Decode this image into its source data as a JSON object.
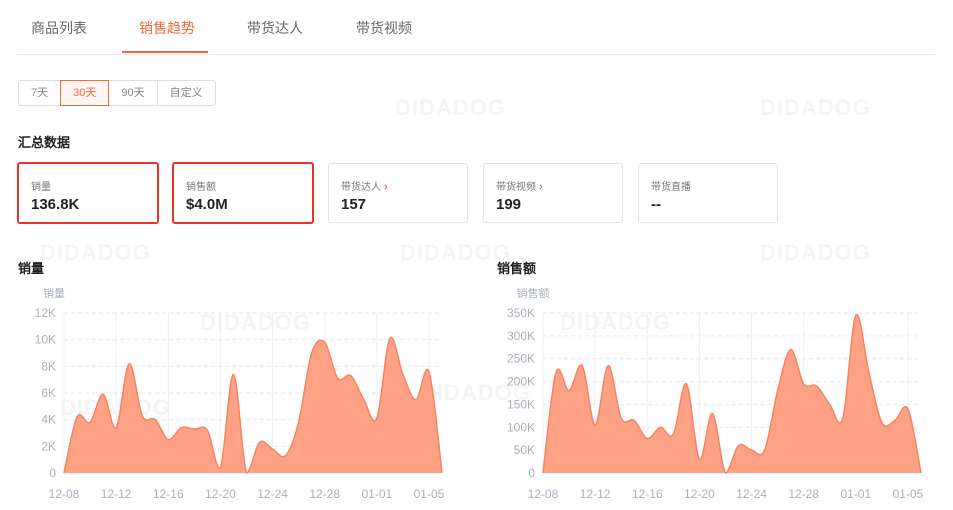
{
  "tabs": [
    {
      "label": "商品列表",
      "active": false
    },
    {
      "label": "销售趋势",
      "active": true
    },
    {
      "label": "带货达人",
      "active": false
    },
    {
      "label": "带货视频",
      "active": false
    }
  ],
  "ranges": [
    {
      "label": "7天",
      "active": false
    },
    {
      "label": "30天",
      "active": true
    },
    {
      "label": "90天",
      "active": false
    },
    {
      "label": "自定义",
      "active": false
    }
  ],
  "summary": {
    "title": "汇总数据",
    "cards": [
      {
        "label": "销量",
        "value": "136.8K",
        "link": false,
        "highlighted": true
      },
      {
        "label": "销售额",
        "value": "$4.0M",
        "link": false,
        "highlighted": true
      },
      {
        "label": "带货达人",
        "value": "157",
        "link": true,
        "highlighted": false
      },
      {
        "label": "带货视频",
        "value": "199",
        "link": true,
        "highlighted": false
      },
      {
        "label": "带货直播",
        "value": "--",
        "link": false,
        "highlighted": false
      }
    ]
  },
  "watermark": "DIDADOG",
  "colors": {
    "accent": "#f06a3a",
    "highlight_border": "#e8332a",
    "area_fill": "#ffa184",
    "area_stroke": "#f58466"
  },
  "chart_data": [
    {
      "type": "area",
      "title": "销量",
      "ylabel": "销量",
      "ylim": [
        0,
        12000
      ],
      "yticks": [
        0,
        2000,
        4000,
        6000,
        8000,
        10000,
        12000
      ],
      "ytick_labels": [
        "0",
        "2K",
        "4K",
        "6K",
        "8K",
        "10K",
        "12K"
      ],
      "xtick_labels": [
        "12-08",
        "12-12",
        "12-16",
        "12-20",
        "12-24",
        "12-28",
        "01-01",
        "01-05"
      ],
      "xtick_index": [
        0,
        4,
        8,
        12,
        16,
        20,
        24,
        28
      ],
      "x": [
        "12-08",
        "12-09",
        "12-10",
        "12-11",
        "12-12",
        "12-13",
        "12-14",
        "12-15",
        "12-16",
        "12-17",
        "12-18",
        "12-19",
        "12-20",
        "12-21",
        "12-22",
        "12-23",
        "12-24",
        "12-25",
        "12-26",
        "12-27",
        "12-28",
        "12-29",
        "12-30",
        "12-31",
        "01-01",
        "01-02",
        "01-03",
        "01-04",
        "01-05",
        "01-06"
      ],
      "values": [
        0,
        4200,
        3800,
        5900,
        3400,
        8200,
        4300,
        4000,
        2500,
        3400,
        3300,
        3200,
        400,
        7400,
        0,
        2300,
        1800,
        1300,
        3800,
        9000,
        9800,
        7100,
        7300,
        5500,
        4100,
        10100,
        7400,
        5500,
        7600,
        0
      ],
      "grid": true,
      "legend": "none"
    },
    {
      "type": "area",
      "title": "销售额",
      "ylabel": "销售额",
      "ylim": [
        0,
        350000
      ],
      "yticks": [
        0,
        50000,
        100000,
        150000,
        200000,
        250000,
        300000,
        350000
      ],
      "ytick_labels": [
        "0",
        "50K",
        "100K",
        "150K",
        "200K",
        "250K",
        "300K",
        "350K"
      ],
      "xtick_labels": [
        "12-08",
        "12-12",
        "12-16",
        "12-20",
        "12-24",
        "12-28",
        "01-01",
        "01-05"
      ],
      "xtick_index": [
        0,
        4,
        8,
        12,
        16,
        20,
        24,
        28
      ],
      "x": [
        "12-08",
        "12-09",
        "12-10",
        "12-11",
        "12-12",
        "12-13",
        "12-14",
        "12-15",
        "12-16",
        "12-17",
        "12-18",
        "12-19",
        "12-20",
        "12-21",
        "12-22",
        "12-23",
        "12-24",
        "12-25",
        "12-26",
        "12-27",
        "12-28",
        "12-29",
        "12-30",
        "12-31",
        "01-01",
        "01-02",
        "01-03",
        "01-04",
        "01-05",
        "01-06"
      ],
      "values": [
        0,
        220000,
        180000,
        235000,
        105000,
        235000,
        120000,
        115000,
        75000,
        100000,
        85000,
        195000,
        30000,
        130000,
        0,
        60000,
        50000,
        50000,
        180000,
        270000,
        195000,
        190000,
        150000,
        120000,
        345000,
        220000,
        110000,
        115000,
        140000,
        0
      ],
      "grid": true,
      "legend": "none"
    }
  ]
}
